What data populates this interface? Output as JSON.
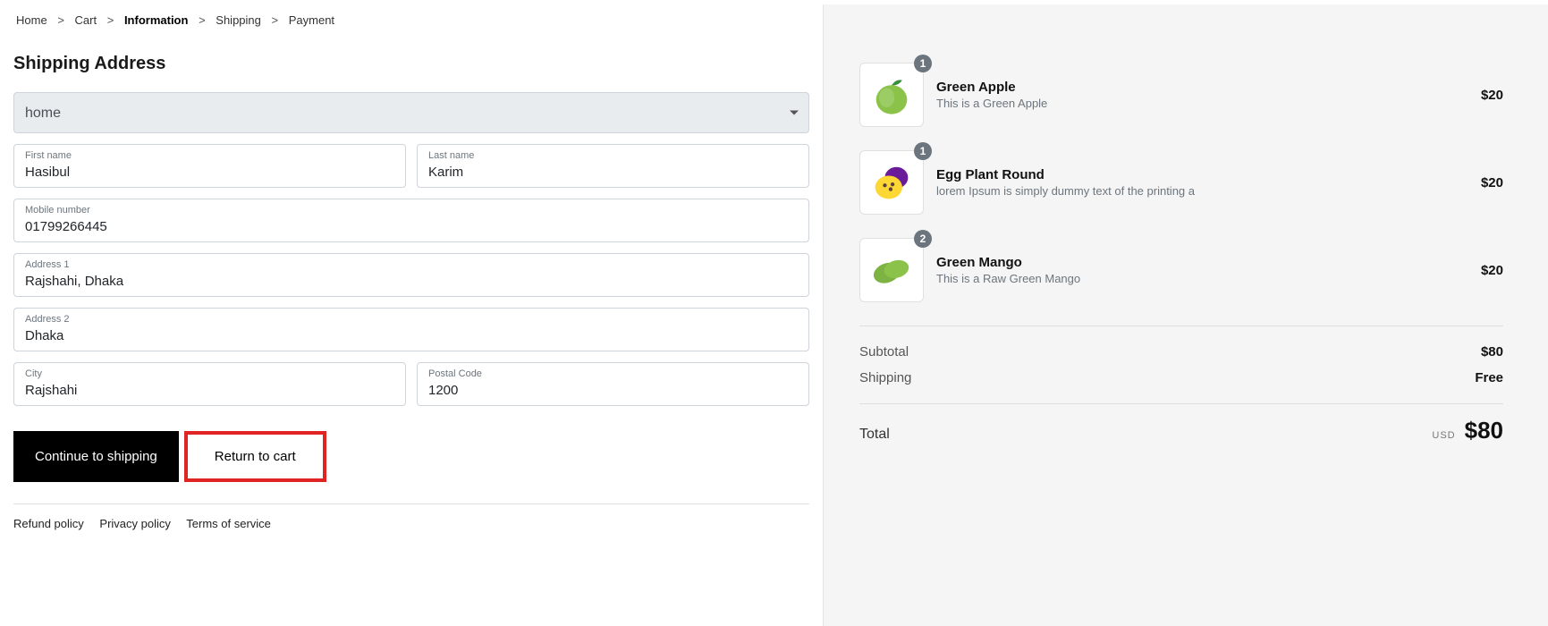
{
  "breadcrumb": [
    {
      "label": "Home",
      "active": false
    },
    {
      "label": "Cart",
      "active": false
    },
    {
      "label": "Information",
      "active": true
    },
    {
      "label": "Shipping",
      "active": false
    },
    {
      "label": "Payment",
      "active": false
    }
  ],
  "title": "Shipping Address",
  "address_select": {
    "value": "home"
  },
  "fields": {
    "first_name": {
      "label": "First name",
      "value": "Hasibul"
    },
    "last_name": {
      "label": "Last name",
      "value": "Karim"
    },
    "mobile": {
      "label": "Mobile number",
      "value": "01799266445"
    },
    "address1": {
      "label": "Address 1",
      "value": "Rajshahi, Dhaka"
    },
    "address2": {
      "label": "Address 2",
      "value": "Dhaka"
    },
    "city": {
      "label": "City",
      "value": "Rajshahi"
    },
    "postal": {
      "label": "Postal Code",
      "value": "1200"
    }
  },
  "actions": {
    "continue": "Continue to shipping",
    "return": "Return to cart"
  },
  "footer": {
    "refund": "Refund policy",
    "privacy": "Privacy policy",
    "terms": "Terms of service"
  },
  "cart": [
    {
      "name": "Green Apple",
      "desc": "This is a Green Apple",
      "qty": "1",
      "price": "$20",
      "icon": "apple"
    },
    {
      "name": "Egg Plant Round",
      "desc": "lorem Ipsum is simply dummy text of the printing a",
      "qty": "1",
      "price": "$20",
      "icon": "passion"
    },
    {
      "name": "Green Mango",
      "desc": "This is a Raw Green Mango",
      "qty": "2",
      "price": "$20",
      "icon": "mango"
    }
  ],
  "summary": {
    "subtotal_label": "Subtotal",
    "subtotal_value": "$80",
    "shipping_label": "Shipping",
    "shipping_value": "Free",
    "total_label": "Total",
    "total_currency": "USD",
    "total_value": "$80"
  }
}
